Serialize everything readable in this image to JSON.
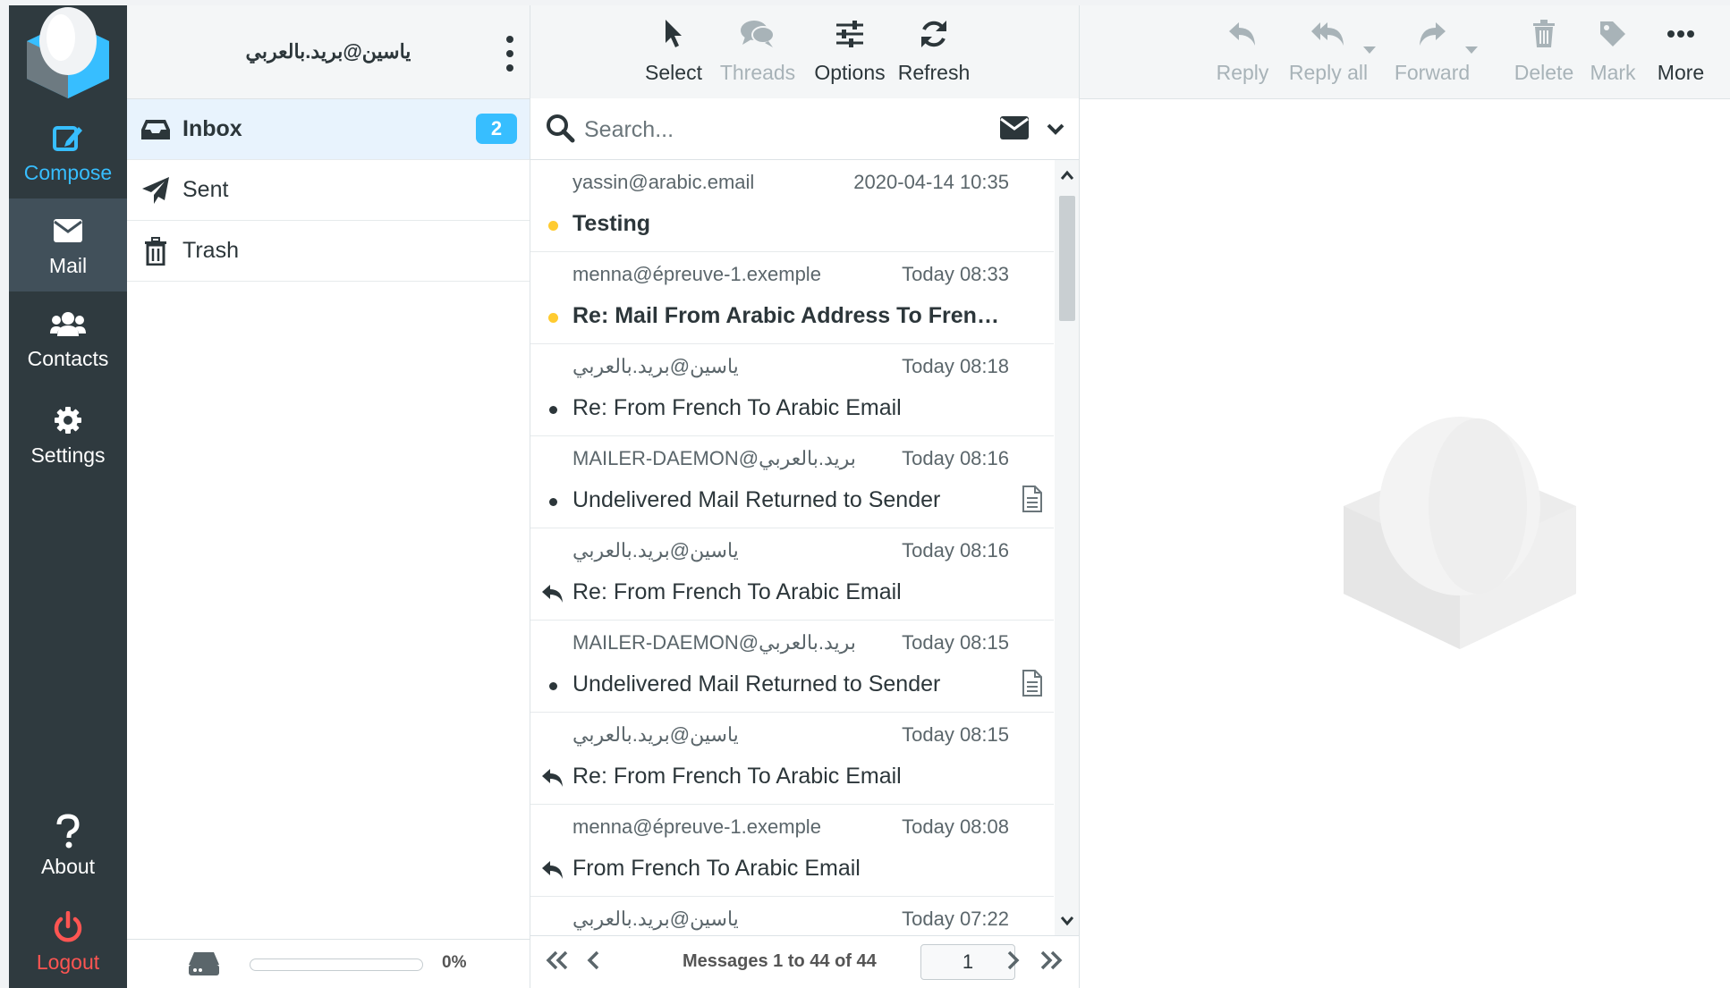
{
  "nav": {
    "compose": "Compose",
    "mail": "Mail",
    "contacts": "Contacts",
    "settings": "Settings",
    "about": "About",
    "logout": "Logout"
  },
  "account": {
    "name": "ياسين@بريد.بالعربي"
  },
  "folders": [
    {
      "name": "Inbox",
      "unread": "2"
    },
    {
      "name": "Sent"
    },
    {
      "name": "Trash"
    }
  ],
  "quota": {
    "percent_label": "0%",
    "fraction": 0
  },
  "list_toolbar": {
    "select": "Select",
    "threads": "Threads",
    "options": "Options",
    "refresh": "Refresh"
  },
  "search": {
    "placeholder": "Search..."
  },
  "messages": [
    {
      "from": "yassin@arabic.email",
      "date": "2020-04-14 10:35",
      "subject": "Testing",
      "status": "unread",
      "attachment": false
    },
    {
      "from": "menna@épreuve-1.exemple",
      "date": "Today 08:33",
      "subject": "Re: Mail From Arabic Address To French Ad...",
      "status": "unread",
      "attachment": false
    },
    {
      "from": "ياسين@بريد.بالعربي",
      "date": "Today 08:18",
      "subject": "Re: From French To Arabic Email",
      "status": "read",
      "attachment": false
    },
    {
      "from": "MAILER-DAEMON@بريد.بالعربي",
      "date": "Today 08:16",
      "subject": "Undelivered Mail Returned to Sender",
      "status": "read",
      "attachment": true
    },
    {
      "from": "ياسين@بريد.بالعربي",
      "date": "Today 08:16",
      "subject": "Re: From French To Arabic Email",
      "status": "replied",
      "attachment": false
    },
    {
      "from": "MAILER-DAEMON@بريد.بالعربي",
      "date": "Today 08:15",
      "subject": "Undelivered Mail Returned to Sender",
      "status": "read",
      "attachment": true
    },
    {
      "from": "ياسين@بريد.بالعربي",
      "date": "Today 08:15",
      "subject": "Re: From French To Arabic Email",
      "status": "replied",
      "attachment": false
    },
    {
      "from": "menna@épreuve-1.exemple",
      "date": "Today 08:08",
      "subject": "From French To Arabic Email",
      "status": "replied",
      "attachment": false
    },
    {
      "from": "ياسين@بريد.بالعربي",
      "date": "Today 07:22",
      "subject": "",
      "status": "read",
      "attachment": false
    }
  ],
  "pagination": {
    "count_text": "Messages 1 to 44 of 44",
    "page": "1"
  },
  "preview_toolbar": {
    "reply": "Reply",
    "reply_all": "Reply all",
    "forward": "Forward",
    "delete": "Delete",
    "mark": "Mark",
    "more": "More"
  },
  "colors": {
    "accent": "#37beff",
    "nav_bg": "#2f3a3f",
    "logout": "#ff5552",
    "unread_dot": "#ffcb30"
  }
}
